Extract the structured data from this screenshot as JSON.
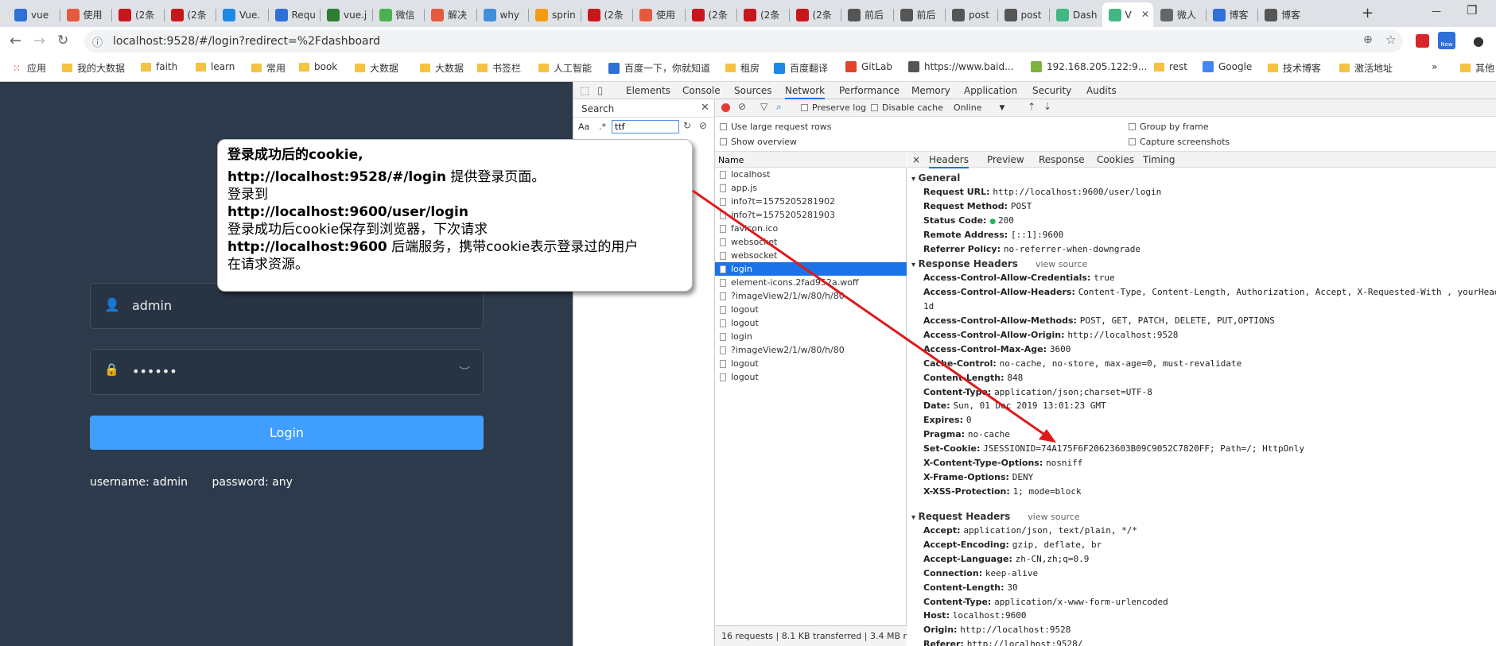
{
  "browser": {
    "tabs": [
      {
        "label": "vue",
        "color": "#2f6fd8"
      },
      {
        "label": "使用",
        "color": "#e55a3c"
      },
      {
        "label": "(2条",
        "color": "#c8161d"
      },
      {
        "label": "(2条",
        "color": "#c8161d"
      },
      {
        "label": "Vue.",
        "color": "#1e88e5"
      },
      {
        "label": "Requ",
        "color": "#2f6fd8"
      },
      {
        "label": "vue.j",
        "color": "#2e7d32"
      },
      {
        "label": "微信",
        "color": "#4caf50"
      },
      {
        "label": "解决",
        "color": "#e55a3c"
      },
      {
        "label": "why",
        "color": "#3f8ed8"
      },
      {
        "label": "sprin",
        "color": "#f39c12"
      },
      {
        "label": "(2条",
        "color": "#c8161d"
      },
      {
        "label": "使用",
        "color": "#e55a3c"
      },
      {
        "label": "(2条",
        "color": "#c8161d"
      },
      {
        "label": "(2条",
        "color": "#c8161d"
      },
      {
        "label": "(2条",
        "color": "#c8161d"
      },
      {
        "label": "前后",
        "color": "#555555"
      },
      {
        "label": "前后",
        "color": "#555555"
      },
      {
        "label": "post",
        "color": "#555555"
      },
      {
        "label": "post",
        "color": "#555555"
      },
      {
        "label": "Dash",
        "color": "#41b883"
      },
      {
        "label": "V",
        "color": "#41b883"
      },
      {
        "label": "微人",
        "color": "#666666"
      },
      {
        "label": "博客",
        "color": "#2f6fd8"
      },
      {
        "label": "博客",
        "color": "#555555"
      }
    ],
    "url": "localhost:9528/#/login?redirect=%2Fdashboard",
    "bookmarks": [
      {
        "label": "应用",
        "kind": "apps"
      },
      {
        "label": "我的大数据",
        "kind": "folder"
      },
      {
        "label": "faith",
        "kind": "folder"
      },
      {
        "label": "learn",
        "kind": "folder"
      },
      {
        "label": "常用",
        "kind": "folder"
      },
      {
        "label": "book",
        "kind": "folder"
      },
      {
        "label": "大数据",
        "kind": "folder"
      },
      {
        "label": "大数据",
        "kind": "folder"
      },
      {
        "label": "书签栏",
        "kind": "folder"
      },
      {
        "label": "人工智能",
        "kind": "folder"
      },
      {
        "label": "百度一下，你就知道",
        "kind": "site",
        "color": "#2f6fd8"
      },
      {
        "label": "租房",
        "kind": "folder"
      },
      {
        "label": "百度翻译",
        "kind": "site",
        "color": "#1e88e5"
      },
      {
        "label": "GitLab",
        "kind": "site",
        "color": "#e24329"
      },
      {
        "label": "https://www.baid...",
        "kind": "site",
        "color": "#555555"
      },
      {
        "label": "192.168.205.122:9...",
        "kind": "site",
        "color": "#7cb342"
      },
      {
        "label": "rest",
        "kind": "folder"
      },
      {
        "label": "Google",
        "kind": "site",
        "color": "#4285f4"
      },
      {
        "label": "技术博客",
        "kind": "folder"
      },
      {
        "label": "激活地址",
        "kind": "folder"
      },
      {
        "label": "»",
        "kind": "more"
      },
      {
        "label": "其他",
        "kind": "folder"
      }
    ]
  },
  "login": {
    "username_value": "admin",
    "password_value": "••••••",
    "button_label": "Login",
    "tip_username": "username: admin",
    "tip_password": "password: any"
  },
  "callout": {
    "line1": "登录成功后的cookie,",
    "line2_url": "http://localhost:9528/#/login",
    "line2_text": " 提供登录页面。",
    "line3": "登录到",
    "line4_url": "http://localhost:9600/user/login",
    "line5": "登录成功后cookie保存到浏览器，下次请求",
    "line6_url": "http://localhost:9600",
    "line6_text": " 后端服务，携带cookie表示登录过的用户",
    "line7": "在请求资源。"
  },
  "devtools": {
    "tabs": [
      "Elements",
      "Console",
      "Sources",
      "Network",
      "Performance",
      "Memory",
      "Application",
      "Security",
      "Audits"
    ],
    "active_tab": "Network",
    "search_label": "Search",
    "search_value": "ttf",
    "match_case": "Aa",
    "regex": ".*",
    "preserve_log": "Preserve log",
    "disable_cache": "Disable cache",
    "throttle": "Online",
    "large_rows": "Use large request rows",
    "show_overview": "Show overview",
    "group_by_frame": "Group by frame",
    "capture_screenshots": "Capture screenshots",
    "name_header": "Name",
    "requests": [
      "localhost",
      "app.js",
      "info?t=1575205281902",
      "info?t=1575205281903",
      "favicon.ico",
      "websocket",
      "websocket",
      "login",
      "element-icons.2fad952a.woff",
      "?imageView2/1/w/80/h/80",
      "logout",
      "logout",
      "login",
      "?imageView2/1/w/80/h/80",
      "logout",
      "logout"
    ],
    "selected_request": 7,
    "detail_tabs": [
      "×",
      "Headers",
      "Preview",
      "Response",
      "Cookies",
      "Timing"
    ],
    "status_summary": "16 requests  |  8.1 KB transferred  |  3.4 MB r",
    "general_title": "General",
    "general": [
      {
        "k": "Request URL:",
        "v": "http://localhost:9600/user/login"
      },
      {
        "k": "Request Method:",
        "v": "POST"
      },
      {
        "k": "Status Code:",
        "v": "200"
      },
      {
        "k": "Remote Address:",
        "v": "[::1]:9600"
      },
      {
        "k": "Referrer Policy:",
        "v": "no-referrer-when-downgrade"
      }
    ],
    "response_title": "Response Headers",
    "view_source": "view source",
    "response_headers": [
      {
        "k": "Access-Control-Allow-Credentials:",
        "v": "true"
      },
      {
        "k": "Access-Control-Allow-Headers:",
        "v": "Content-Type, Content-Length, Authorization, Accept, X-Requested-With , yourHeader"
      },
      {
        "k": "",
        "v": "1d"
      },
      {
        "k": "Access-Control-Allow-Methods:",
        "v": "POST, GET, PATCH, DELETE, PUT,OPTIONS"
      },
      {
        "k": "Access-Control-Allow-Origin:",
        "v": "http://localhost:9528"
      },
      {
        "k": "Access-Control-Max-Age:",
        "v": "3600"
      },
      {
        "k": "Cache-Control:",
        "v": "no-cache, no-store, max-age=0, must-revalidate"
      },
      {
        "k": "Content-Length:",
        "v": "848"
      },
      {
        "k": "Content-Type:",
        "v": "application/json;charset=UTF-8"
      },
      {
        "k": "Date:",
        "v": "Sun, 01 Dec 2019 13:01:23 GMT"
      },
      {
        "k": "Expires:",
        "v": "0"
      },
      {
        "k": "Pragma:",
        "v": "no-cache"
      },
      {
        "k": "Set-Cookie:",
        "v": "JSESSIONID=74A175F6F20623603B09C9052C7820FF; Path=/; HttpOnly"
      },
      {
        "k": "X-Content-Type-Options:",
        "v": "nosniff"
      },
      {
        "k": "X-Frame-Options:",
        "v": "DENY"
      },
      {
        "k": "X-XSS-Protection:",
        "v": "1; mode=block"
      }
    ],
    "request_title": "Request Headers",
    "request_headers": [
      {
        "k": "Accept:",
        "v": "application/json, text/plain, */*"
      },
      {
        "k": "Accept-Encoding:",
        "v": "gzip, deflate, br"
      },
      {
        "k": "Accept-Language:",
        "v": "zh-CN,zh;q=0.9"
      },
      {
        "k": "Connection:",
        "v": "keep-alive"
      },
      {
        "k": "Content-Length:",
        "v": "30"
      },
      {
        "k": "Content-Type:",
        "v": "application/x-www-form-urlencoded"
      },
      {
        "k": "Host:",
        "v": "localhost:9600"
      },
      {
        "k": "Origin:",
        "v": "http://localhost:9528"
      },
      {
        "k": "Referer:",
        "v": "http://localhost:9528/"
      }
    ]
  },
  "colors": {
    "annotation_arrow": "#e0191b",
    "status_ok": "#1db954",
    "accent": "#409eff"
  }
}
